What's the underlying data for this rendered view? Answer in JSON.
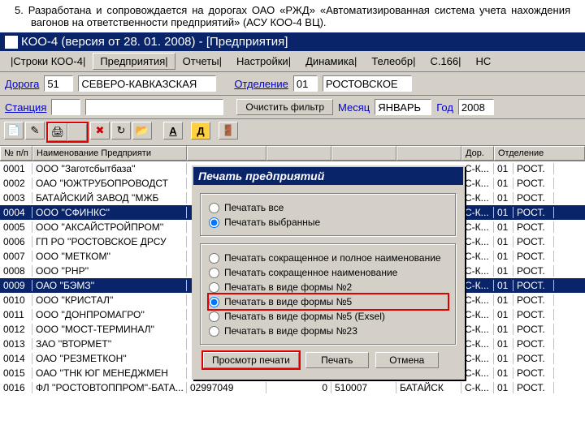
{
  "intro": "5. Разработана и сопровождается на дорогах ОАО «РЖД» «Автоматизированная система учета нахождения вагонов на ответственности предприятий» (АСУ КОО-4 ВЦ).",
  "title": "КОО-4 (версия от 28. 01. 2008) - [Предприятия]",
  "menu": {
    "m0": "|Строки КОО-4|",
    "m1": "Предприятия|",
    "m2": "Отчеты|",
    "m3": "Настройки|",
    "m4": "Динамика|",
    "m5": "Телеобр|",
    "m6": "С.166|",
    "m7": "НС"
  },
  "filter": {
    "doroga_lbl": "Дорога",
    "doroga_code": "51",
    "doroga_name": "СЕВЕРО-КАВКАЗСКАЯ",
    "otd_lbl": "Отделение",
    "otd_code": "01",
    "otd_name": "РОСТОВСКОЕ",
    "stanc_lbl": "Станция",
    "clear": "Очистить фильтр",
    "mes_lbl": "Месяц",
    "mes_val": "ЯНВАРЬ",
    "god_lbl": "Год",
    "god_val": "2008"
  },
  "tool": {
    "d": "Д"
  },
  "cols": {
    "c0": "№ п/п",
    "c1": "Наименование Предприяти",
    "c5": "Дор.",
    "c6": "Отделение"
  },
  "codes": {
    "dor": "С-К...",
    "otd": "01",
    "rost": "РОСТ."
  },
  "rows": [
    {
      "n": "0001",
      "name": "ООО ''Заготсбытбаза''"
    },
    {
      "n": "0002",
      "name": "ОАО ''ЮЖТРУБОПРОВОДСТ"
    },
    {
      "n": "0003",
      "name": "БАТАЙСКИЙ ЗАВОД ''МЖБ"
    },
    {
      "n": "0004",
      "name": "ООО ''СФИНКС''"
    },
    {
      "n": "0005",
      "name": "ООО ''АКСАЙСТРОЙПРОМ''"
    },
    {
      "n": "0006",
      "name": "ГП РО ''РОСТОВСКОЕ ДРСУ"
    },
    {
      "n": "0007",
      "name": "ООО ''МЕТКОМ''"
    },
    {
      "n": "0008",
      "name": "ООО ''РНР''"
    },
    {
      "n": "0009",
      "name": "ОАО ''БЭМЗ''"
    },
    {
      "n": "0010",
      "name": "ООО ''КРИСТАЛ''"
    },
    {
      "n": "0011",
      "name": "ООО ''ДОНПРОМАГРО''"
    },
    {
      "n": "0012",
      "name": "ООО ''МОСТ-ТЕРМИНАЛ''"
    },
    {
      "n": "0013",
      "name": "ЗАО ''ВТОРМЕТ''"
    },
    {
      "n": "0014",
      "name": "ОАО ''РЕЗМЕТКОН''"
    },
    {
      "n": "0015",
      "name": "ОАО ''ТНК ЮГ МЕНЕДЖМЕН"
    },
    {
      "n": "0016",
      "name": "ФЛ ''РОСТОВТОППРОМ''-БАТА...",
      "a": "02997049",
      "b": "0",
      "c": "510007",
      "city": "БАТАЙСК"
    }
  ],
  "dlg": {
    "title": "Печать предприятий",
    "r1": "Печатать все",
    "r2": "Печатать выбранные",
    "r3": "Печатать сокращенное и полное наименование",
    "r4": "Печатать сокращенное наименование",
    "r5": "Печатать в виде формы №2",
    "r6": "Печатать в виде формы №5",
    "r7": "Печатать в виде формы №5 (Exsel)",
    "r8": "Печатать в виде формы №23",
    "b1": "Просмотр печати",
    "b2": "Печать",
    "b3": "Отмена"
  }
}
